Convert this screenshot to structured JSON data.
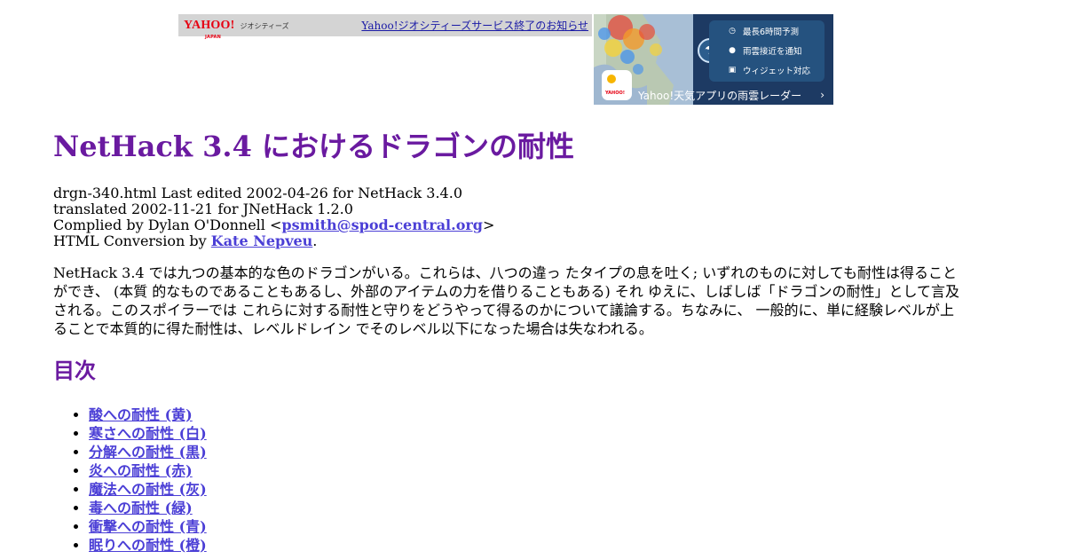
{
  "banner": {
    "logo": "YAHOO!",
    "logo_sub": "JAPAN",
    "logo_service": "ジオシティーズ",
    "notice_link": "Yahoo!ジオシティーズサービス終了のお知らせ"
  },
  "ad": {
    "features": [
      "最長6時間予測",
      "雨雲接近を通知",
      "ウィジェット対応"
    ],
    "feature_icons": [
      "clock-icon",
      "location-pin-icon",
      "widget-icon"
    ],
    "cta": "Yahoo!天気アプリの雨雲レーダー",
    "app_icon_text": "YAHOO!"
  },
  "page": {
    "title": "NetHack 3.4 におけるドラゴンの耐性",
    "meta_line1": "drgn-340.html Last edited 2002-04-26 for NetHack 3.4.0",
    "meta_line2": "translated 2002-11-21 for JNetHack 1.2.0",
    "compiled_prefix": "Complied by Dylan O'Donnell <",
    "compiled_email": "psmith@spod-central.org",
    "compiled_suffix": ">",
    "conversion_prefix": "HTML Conversion by ",
    "conversion_name": "Kate Nepveu",
    "conversion_suffix": ".",
    "intro": "NetHack 3.4 では九つの基本的な色のドラゴンがいる。これらは、八つの違っ たタイプの息を吐く; いずれのものに対しても耐性は得ることができ、 (本質 的なものであることもあるし、外部のアイテムの力を借りることもある) それ ゆえに、しばしば「ドラゴンの耐性」として言及される。このスポイラーでは これらに対する耐性と守りをどうやって得るのかについて議論する。ちなみに、 一般的に、単に経験レベルが上ることで本質的に得た耐性は、レベルドレイン でそのレベル以下になった場合は失なわれる。"
  },
  "toc": {
    "heading": "目次",
    "items": [
      "酸への耐性 (黄)",
      "寒さへの耐性 (白)",
      "分解への耐性 (黒)",
      "炎への耐性 (赤)",
      "魔法への耐性 (灰)",
      "毒への耐性 (緑)",
      "衝撃への耐性 (青)",
      "眠りへの耐性 (橙)"
    ]
  },
  "colors": {
    "heading": "#6a1aa0",
    "link": "#4b3fd6",
    "banner_bg": "#d4d4d4",
    "yahoo_red": "#e60012",
    "ad_bg": "#1d3a63"
  }
}
